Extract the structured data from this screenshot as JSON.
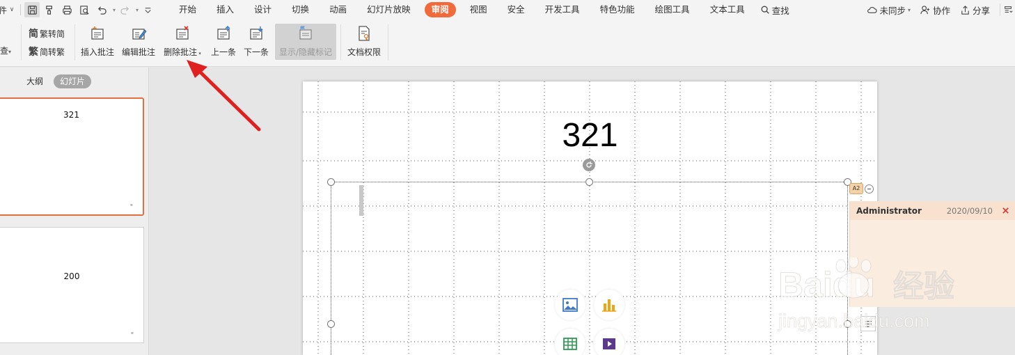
{
  "menubar": {
    "file_label": "文件",
    "tabs": [
      {
        "label": "开始",
        "active": false
      },
      {
        "label": "插入",
        "active": false
      },
      {
        "label": "设计",
        "active": false
      },
      {
        "label": "切换",
        "active": false
      },
      {
        "label": "动画",
        "active": false
      },
      {
        "label": "幻灯片放映",
        "active": false
      },
      {
        "label": "审阅",
        "active": true
      },
      {
        "label": "视图",
        "active": false
      },
      {
        "label": "安全",
        "active": false
      },
      {
        "label": "开发工具",
        "active": false
      },
      {
        "label": "特色功能",
        "active": false
      },
      {
        "label": "绘图工具",
        "active": false
      },
      {
        "label": "文本工具",
        "active": false
      }
    ],
    "search_label": "查找",
    "sync_label": "未同步",
    "collab_label": "协作",
    "share_label": "分享"
  },
  "ribbon": {
    "cut_label": "查",
    "trad_to_simp": "繁转简",
    "simp_to_trad": "简转繁",
    "insert_comment": "插入批注",
    "edit_comment": "编辑批注",
    "delete_comment": "删除批注",
    "prev_comment": "上一条",
    "next_comment": "下一条",
    "show_hide_markup": "显示/隐藏标记",
    "doc_permission": "文档权限"
  },
  "left_panel": {
    "tab_outline": "大纲",
    "tab_slides": "幻灯片",
    "thumbnails": [
      {
        "title": "321",
        "selected": true
      },
      {
        "title": "200",
        "selected": false
      }
    ]
  },
  "slide": {
    "title": "321"
  },
  "comment": {
    "marker_label": "A2",
    "author": "Administrator",
    "date": "2020/09/10"
  },
  "colors": {
    "accent": "#f06a3c",
    "selection": "#e3703f",
    "comment_bg": "#fbece0",
    "arrow": "#e0201e"
  },
  "watermark": {
    "brand": "Baidu",
    "brand_cn": "经验",
    "url": "jingyan.baidu.com"
  }
}
